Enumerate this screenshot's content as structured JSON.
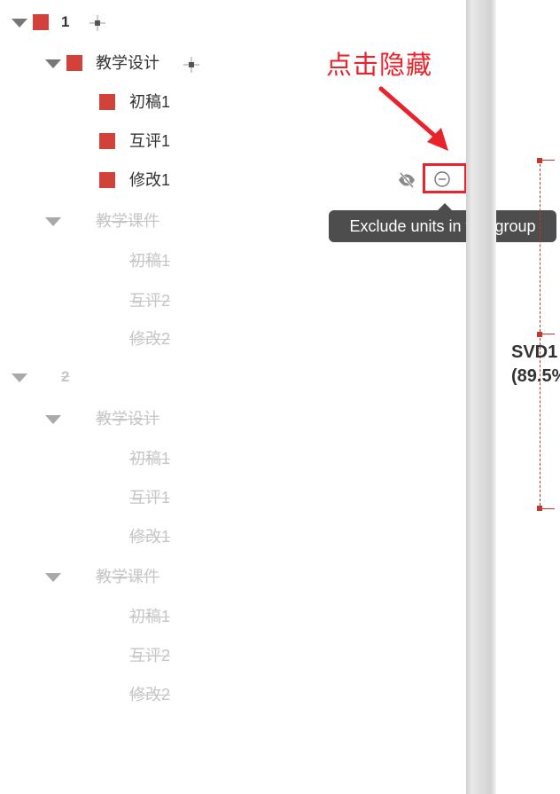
{
  "colors": {
    "swatch_red": "#d0423a",
    "annotation_red": "#e8232b",
    "tooltip_bg": "#4d4d4d",
    "disabled_text": "#c6c6c6",
    "chart_line": "#c0392b"
  },
  "icons": {
    "expand": "caret-down-icon",
    "move": "move-icon",
    "hide": "eye-slash-icon",
    "exclude": "minus-circle-icon"
  },
  "tree": {
    "group1": {
      "label": "1",
      "sub1": {
        "label": "教学设计",
        "items": [
          "初稿1",
          "互评1",
          "修改1"
        ]
      },
      "sub2": {
        "label": "教学课件",
        "items": [
          "初稿1",
          "互评2",
          "修改2"
        ]
      }
    },
    "group2": {
      "label": "2",
      "sub1": {
        "label": "教学设计",
        "items": [
          "初稿1",
          "互评1",
          "修改1"
        ]
      },
      "sub2": {
        "label": "教学课件",
        "items": [
          "初稿1",
          "互评2",
          "修改2"
        ]
      }
    }
  },
  "annotation": {
    "text": "点击隐藏"
  },
  "tooltip": {
    "text": "Exclude units in this group"
  },
  "chart": {
    "label_line1": "SVD1",
    "label_line2": "(89.5%"
  }
}
